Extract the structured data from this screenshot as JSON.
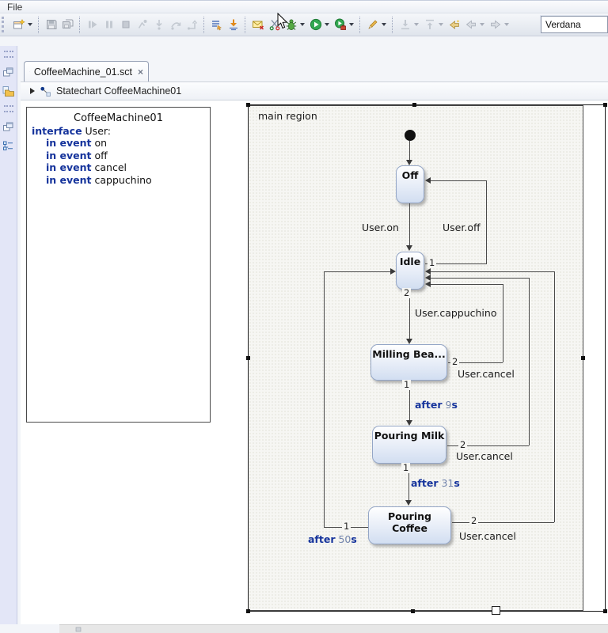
{
  "menu": {
    "file": "File"
  },
  "toolbar": {
    "font_value": "Verdana",
    "buttons": [
      "new-wizard",
      "save",
      "save-all",
      "resume",
      "pause",
      "terminate",
      "disconnect",
      "step-into",
      "step-over",
      "step-return",
      "use-step-filters",
      "drop-to-frame",
      "validate",
      "generate-code",
      "debug",
      "run",
      "run-external",
      "format-diagram",
      "import",
      "export",
      "last-edit-location",
      "back",
      "forward",
      "font-selector"
    ]
  },
  "sidebar": {
    "views": [
      "restore-view",
      "project-explorer",
      "restore-view",
      "outline"
    ]
  },
  "editor": {
    "tab": {
      "title": "CoffeeMachine_01.sct",
      "close_glyph": "×"
    },
    "breadcrumb": {
      "label": "Statechart CoffeeMachine01"
    }
  },
  "interface_box": {
    "title": "CoffeeMachine01",
    "declaration": {
      "kw": "interface",
      "rest": " User:"
    },
    "events": [
      {
        "kw": "in event",
        "rest": " on"
      },
      {
        "kw": "in event",
        "rest": " off"
      },
      {
        "kw": "in event",
        "rest": " cancel"
      },
      {
        "kw": "in event",
        "rest": " cappuchino"
      }
    ]
  },
  "diagram": {
    "region_label": "main region",
    "states": {
      "off": "Off",
      "idle": "Idle",
      "milling": "Milling Bea...",
      "milk": "Pouring Milk",
      "coffee": "Pouring Coffee"
    },
    "transitions": {
      "user_on": {
        "label": "User.on"
      },
      "user_off": {
        "label": "User.off",
        "priority": "1"
      },
      "cappuchino": {
        "label": "User.cappuchino",
        "priority": "2"
      },
      "cancel_milling": {
        "label": "User.cancel",
        "priority": "2"
      },
      "cancel_milk": {
        "label": "User.cancel",
        "priority": "2"
      },
      "cancel_coffee": {
        "label": "User.cancel",
        "priority": "2"
      },
      "after9": {
        "kw": "after",
        "value": " 9",
        "unit": "s",
        "priority": "1"
      },
      "after31": {
        "kw": "after",
        "value": " 31",
        "unit": "s",
        "priority": "1"
      },
      "after50": {
        "kw": "after",
        "value": " 50",
        "unit": "s",
        "priority": "1"
      }
    }
  },
  "colors": {
    "keyword": "#16349c",
    "number": "#7284ac",
    "state_border": "#94a6c6",
    "run_green": "#33a852",
    "selection": "#1a1a1a"
  }
}
